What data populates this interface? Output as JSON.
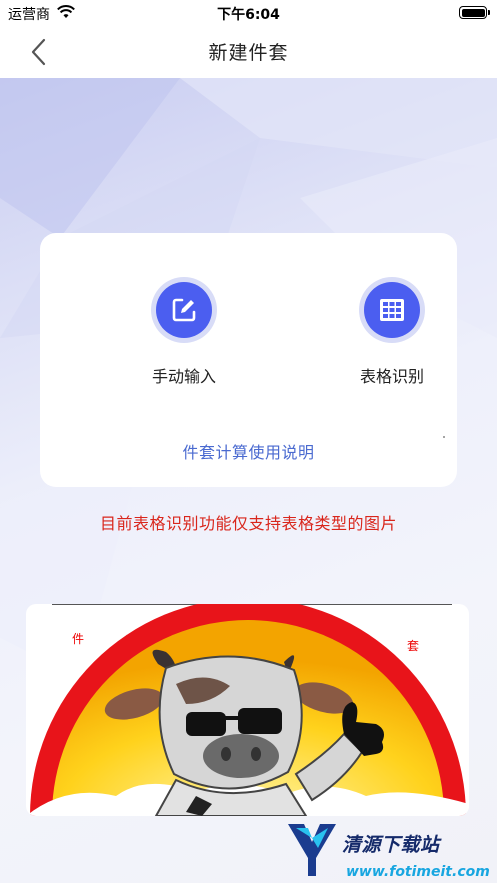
{
  "status_bar": {
    "carrier": "运营商",
    "time": "下午6:04"
  },
  "nav": {
    "title": "新建件套",
    "back_icon": "chevron-left-icon"
  },
  "options": [
    {
      "label": "手动输入",
      "icon": "edit-icon"
    },
    {
      "label": "表格识别",
      "icon": "table-grid-icon"
    }
  ],
  "help_link": "件套计算使用说明",
  "notice": "目前表格识别功能仅支持表格类型的图片",
  "example": {
    "char_left": "件",
    "char_right": "套"
  },
  "watermark": {
    "title": "清源下载站",
    "url": "www.fotimeit.com"
  },
  "colors": {
    "accent": "#4b5ef0",
    "link": "#4a6ad0",
    "notice": "#d9261c"
  }
}
